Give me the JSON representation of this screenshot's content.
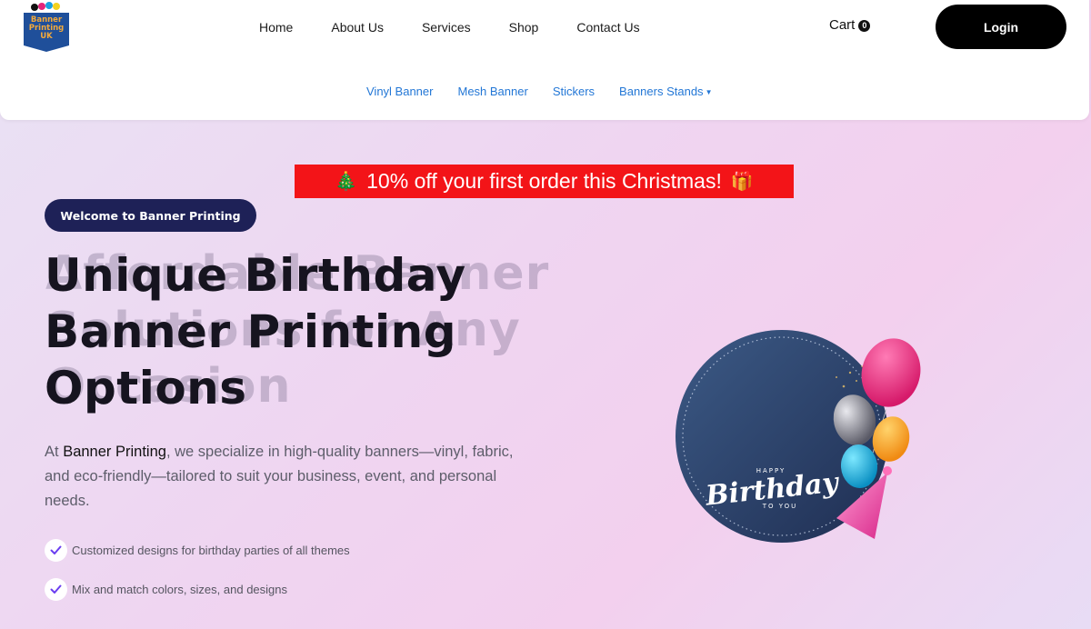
{
  "logo": {
    "line1": "Banner",
    "line2": "Printing",
    "line3": "UK"
  },
  "nav": {
    "items": [
      "Home",
      "About Us",
      "Services",
      "Shop",
      "Contact Us"
    ],
    "cart_label": "Cart",
    "cart_count": "0",
    "login_label": "Login"
  },
  "subnav": {
    "items": [
      "Vinyl Banner",
      "Mesh Banner",
      "Stickers",
      "Banners Stands"
    ]
  },
  "promo": {
    "left_emoji": "🎄",
    "text": "10% off your first order this Christmas!",
    "right_emoji": "🎁"
  },
  "hero": {
    "welcome": "Welcome to Banner Printing",
    "title_line1": "Unique Birthday",
    "title_line2": "Banner Printing",
    "title_line3": "Options",
    "ghost_line1": "Affordable Banner",
    "ghost_line2": "Solutions for Any",
    "ghost_line3": "Occasion",
    "desc_prefix": "At ",
    "desc_brand": "Banner Printing",
    "desc_rest": ", we specialize in high-quality banners—vinyl, fabric, and eco-friendly—tailored to suit your business, event, and personal needs.",
    "checks": [
      "Customized designs for birthday parties of all themes",
      "Mix and match colors, sizes, and designs"
    ]
  },
  "graphic": {
    "happy": "HAPPY",
    "birthday": "Birthday",
    "to_you": "TO YOU"
  },
  "colors": {
    "promo_bg": "#f31418",
    "pill_bg": "#1e2157",
    "subnav_link": "#2377d6",
    "check_mark": "#6a3df0"
  }
}
